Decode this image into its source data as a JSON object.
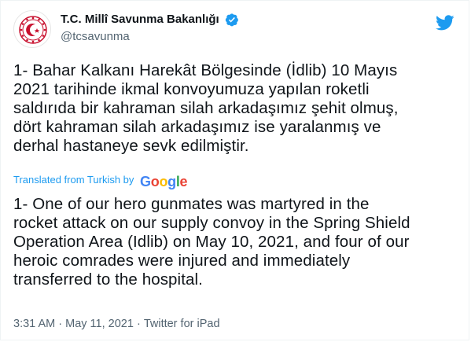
{
  "account": {
    "display_name": "T.C. Millî Savunma Bakanlığı",
    "handle": "@tcsavunma",
    "verified_icon": "verified-badge-icon",
    "accent_color": "#1d9bf0"
  },
  "tweet": {
    "text": "1- Bahar Kalkanı Harekât Bölgesinde (İdlib) 10 Mayıs\n2021 tarihinde ikmal konvoyumuza yapılan roketli\nsaldırıda bir kahraman silah arkadaşımız şehit olmuş,\ndört kahraman silah arkadaşımız ise yaralanmış ve\nderhal hastaneye sevk edilmiştir.",
    "translated_label": "Translated from Turkish by",
    "translator_brand": [
      "G",
      "o",
      "o",
      "g",
      "l",
      "e"
    ],
    "translation": "1- One of our hero gunmates was martyred in the\nrocket attack on our supply convoy in the Spring Shield\nOperation Area (Idlib) on May 10, 2021, and four of our\nheroic comrades were injured and immediately\ntransferred to the hospital.",
    "time": "3:31 AM",
    "separator": "·",
    "date": "May 11, 2021",
    "source": "Twitter for iPad"
  }
}
